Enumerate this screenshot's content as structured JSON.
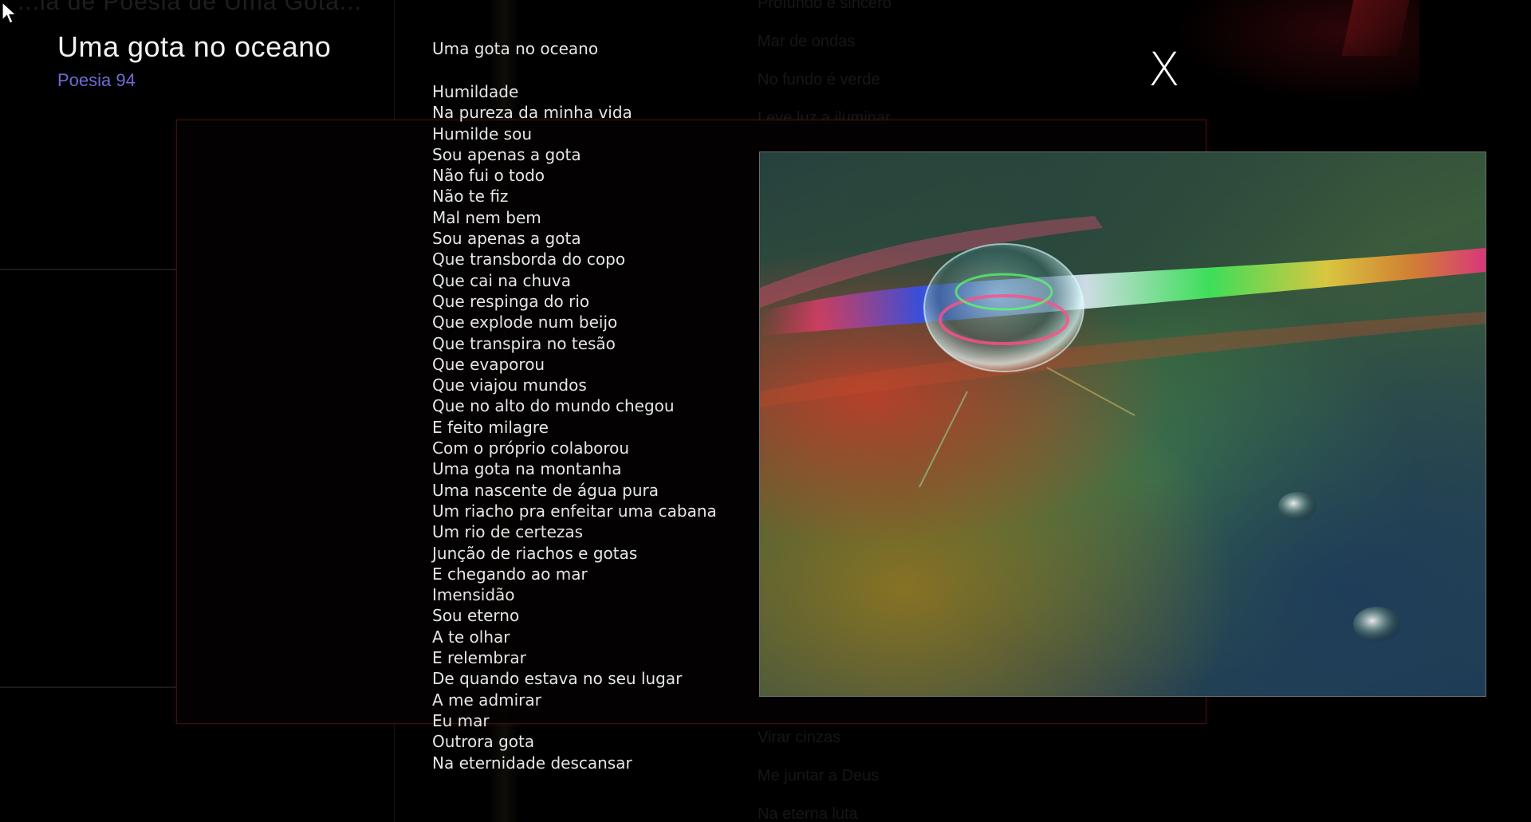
{
  "background": {
    "faint_title": "...ia de Poesia de Uma Gota...",
    "faint_list_top": [
      "Profundo e sincero",
      "Mar de ondas",
      "No fundo é verde",
      "Leve luz a iluminar"
    ],
    "faint_list_bottom": [
      "Virar cinzas",
      "Me juntar a Deus",
      "Na eterna luta"
    ]
  },
  "poem": {
    "title": "Uma gota no oceano",
    "subtitle": "Poesia 94",
    "heading": "Uma gota no oceano",
    "lines": [
      "Humildade",
      "Na pureza da minha vida",
      "Humilde sou",
      "Sou apenas a gota",
      "Não fui o todo",
      "Não te fiz",
      "Mal nem bem",
      "Sou apenas a gota",
      "Que transborda do copo",
      "Que cai na chuva",
      "Que respinga do rio",
      "Que explode num beijo",
      "Que transpira no tesão",
      "Que evaporou",
      "Que viajou mundos",
      "Que no alto do mundo chegou",
      "E feito milagre",
      "Com o próprio colaborou",
      "Uma gota na montanha",
      "Uma nascente de água pura",
      "Um riacho pra enfeitar uma cabana",
      "Um rio de certezas",
      "Junção de riachos e gotas",
      "E chegando ao mar",
      "Imensidão",
      "Sou eterno",
      "A te olhar",
      "E relembrar",
      "De quando estava no seu lugar",
      "A me admirar",
      "Eu mar",
      "Outrora gota",
      "Na eternidade descansar"
    ]
  },
  "close": {
    "label": "X"
  },
  "colors": {
    "subtitle": "#6f6bd6",
    "panel_border": "#3a1512",
    "text": "#e6e6e6"
  },
  "icons": {
    "cursor": "mouse-pointer-icon"
  }
}
